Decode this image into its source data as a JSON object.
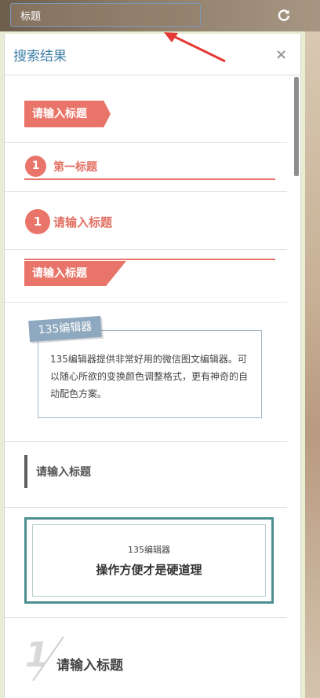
{
  "search": {
    "value": "标题"
  },
  "icons": {
    "refresh": "refresh-icon",
    "close": "close-icon"
  },
  "panel": {
    "title": "搜索结果",
    "close": "×"
  },
  "results": [
    {
      "label": "请输入标题"
    },
    {
      "number": "1",
      "label": "第一标题"
    },
    {
      "number": "1",
      "label": "请输入标题"
    },
    {
      "label": "请输入标题"
    },
    {
      "tag": "135编辑器",
      "body": "135编辑器提供非常好用的微信图文编辑器。可以随心所欲的变换颜色调整格式，更有神奇的自动配色方案。"
    },
    {
      "label": "请输入标题"
    },
    {
      "small": "135编辑器",
      "big": "操作方便才是硬道理"
    },
    {
      "number": "1",
      "label": "请输入标题"
    }
  ],
  "colors": {
    "accent": "#e9756a",
    "title_blue": "#3f7fa7",
    "teal": "#4d8f8f",
    "tag_blue": "#8ea9bf",
    "annotation_red": "#e53935"
  }
}
